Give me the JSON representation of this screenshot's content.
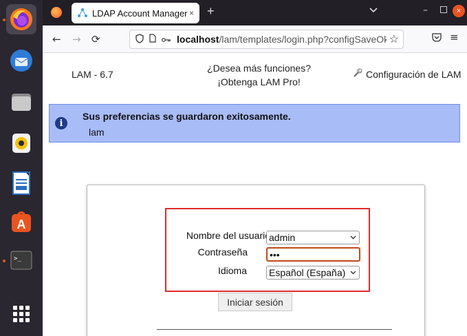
{
  "browser": {
    "tab_title": "LDAP Account Manager",
    "tab_close": "×",
    "new_tab": "+",
    "url_host": "localhost",
    "url_path": "/lam/templates/login.php?configSaveOk",
    "win_close": "×"
  },
  "header": {
    "version": "LAM - 6.7",
    "promo_line1": "¿Desea más funciones?",
    "promo_line2": "¡Obtenga LAM Pro!",
    "config_link": "Configuración de LAM"
  },
  "alert": {
    "title": "Sus preferencias se guardaron exitosamente.",
    "text": "lam",
    "icon": "i"
  },
  "login": {
    "username_label": "Nombre del usuario",
    "username_value": "admin",
    "password_label": "Contraseña",
    "password_value": "•••",
    "language_label": "Idioma",
    "language_value": "Español (España)",
    "submit_label": "Iniciar sesión"
  },
  "colors": {
    "alert_bg": "#a8bcf8",
    "highlight": "#e02a2a",
    "dock_bg": "#2a2730",
    "accent": "#e95420"
  }
}
